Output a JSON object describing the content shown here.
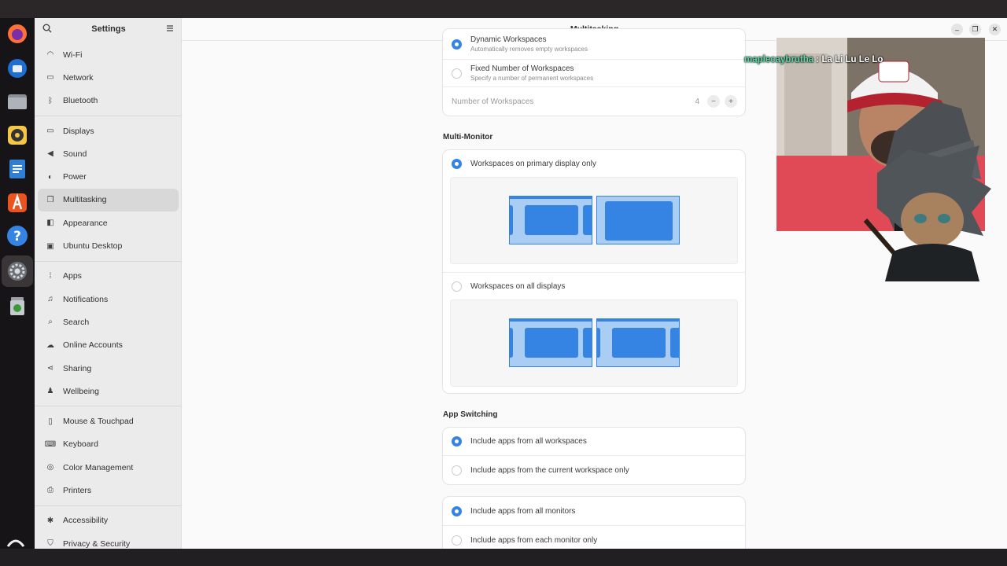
{
  "window": {
    "title": "Multitasking"
  },
  "sidebar": {
    "title": "Settings",
    "groups": [
      [
        {
          "label": "Wi-Fi",
          "icon": "wifi-icon",
          "glyph": "◠"
        },
        {
          "label": "Network",
          "icon": "network-icon",
          "glyph": "▭"
        },
        {
          "label": "Bluetooth",
          "icon": "bluetooth-icon",
          "glyph": "ᛒ"
        }
      ],
      [
        {
          "label": "Displays",
          "icon": "display-icon",
          "glyph": "▭"
        },
        {
          "label": "Sound",
          "icon": "speaker-icon",
          "glyph": "◀"
        },
        {
          "label": "Power",
          "icon": "power-icon",
          "glyph": "◐"
        },
        {
          "label": "Multitasking",
          "icon": "multitasking-icon",
          "glyph": "❐",
          "active": true
        },
        {
          "label": "Appearance",
          "icon": "appearance-icon",
          "glyph": "◧"
        },
        {
          "label": "Ubuntu Desktop",
          "icon": "ubuntu-desktop-icon",
          "glyph": "▣"
        }
      ],
      [
        {
          "label": "Apps",
          "icon": "apps-icon",
          "glyph": "⁞"
        },
        {
          "label": "Notifications",
          "icon": "bell-icon",
          "glyph": "♫"
        },
        {
          "label": "Search",
          "icon": "search-icon",
          "glyph": "⌕"
        },
        {
          "label": "Online Accounts",
          "icon": "cloud-icon",
          "glyph": "☁"
        },
        {
          "label": "Sharing",
          "icon": "share-icon",
          "glyph": "⋖"
        },
        {
          "label": "Wellbeing",
          "icon": "wellbeing-icon",
          "glyph": "♟"
        }
      ],
      [
        {
          "label": "Mouse & Touchpad",
          "icon": "mouse-icon",
          "glyph": "▯"
        },
        {
          "label": "Keyboard",
          "icon": "keyboard-icon",
          "glyph": "⌨"
        },
        {
          "label": "Color Management",
          "icon": "color-icon",
          "glyph": "◎"
        },
        {
          "label": "Printers",
          "icon": "printer-icon",
          "glyph": "⎙"
        }
      ],
      [
        {
          "label": "Accessibility",
          "icon": "accessibility-icon",
          "glyph": "✱"
        },
        {
          "label": "Privacy & Security",
          "icon": "privacy-icon",
          "glyph": "⛉"
        }
      ]
    ]
  },
  "workspaces": {
    "dynamic_label": "Dynamic Workspaces",
    "dynamic_sub": "Automatically removes empty workspaces",
    "fixed_label": "Fixed Number of Workspaces",
    "fixed_sub": "Specify a number of permanent workspaces",
    "number_label": "Number of Workspaces",
    "number_value": "4",
    "minus": "−",
    "plus": "+"
  },
  "multi_monitor": {
    "title": "Multi-Monitor",
    "primary_label": "Workspaces on primary display only",
    "all_label": "Workspaces on all displays"
  },
  "app_switching": {
    "title": "App Switching",
    "all_workspaces": "Include apps from all workspaces",
    "current_workspace": "Include apps from the current workspace only",
    "all_monitors": "Include apps from all monitors",
    "each_monitor": "Include apps from each monitor only"
  },
  "overlay": {
    "chat_user": "maplecaybrutha",
    "chat_sep": " : ",
    "chat_message": "La Li Lu Le Lo"
  },
  "controls": {
    "minimize": "–",
    "maximize": "❐",
    "close": "✕"
  },
  "colors": {
    "accent": "#3584e4",
    "chat_user": "#59d9a4"
  }
}
